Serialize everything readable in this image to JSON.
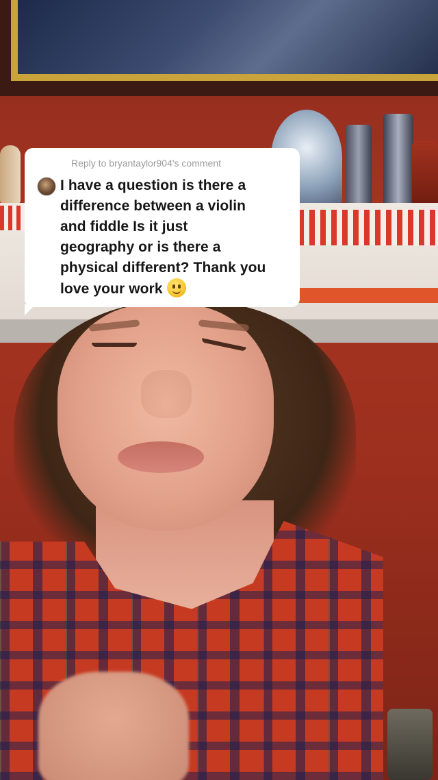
{
  "reply_bubble": {
    "header": "Reply to bryantaylor904's comment",
    "lines": [
      "I have a question is there a",
      "difference between a violin",
      "and fiddle Is it just",
      "geography or is there a",
      "physical different? Thank you",
      "love your work"
    ],
    "emoji": "slightly-smiling-face-emoji",
    "avatar_icon": "commenter-avatar"
  }
}
